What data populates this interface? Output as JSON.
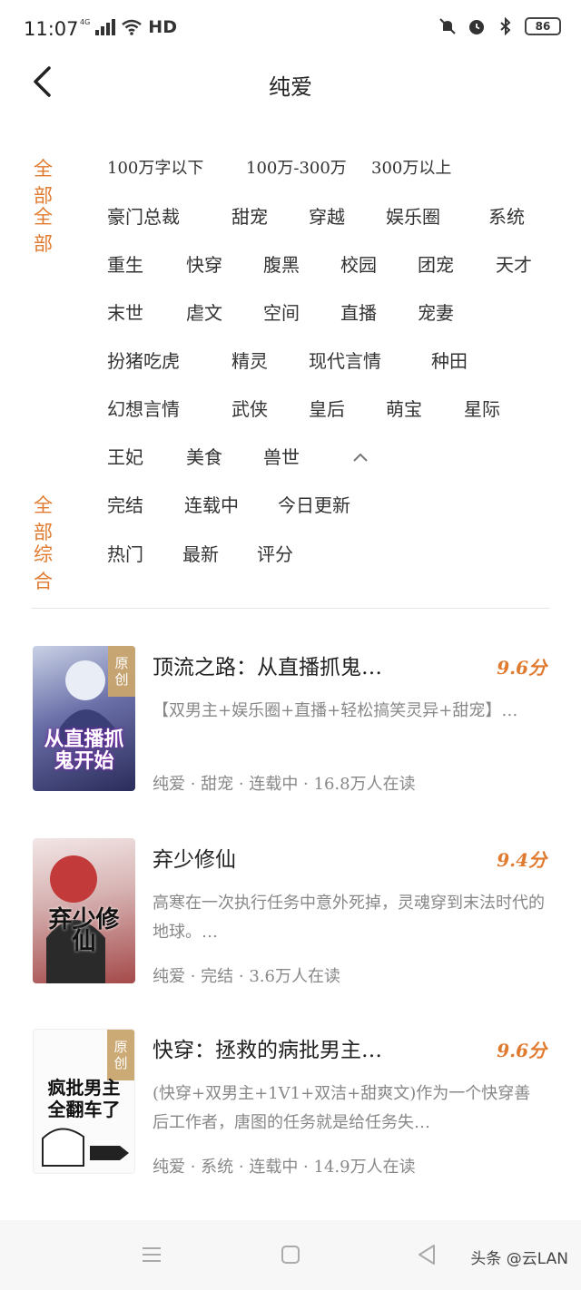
{
  "status_bar": {
    "time": "11:07",
    "network": "4G",
    "hd_label": "HD",
    "battery": "86"
  },
  "header": {
    "title": "纯爱"
  },
  "filters": {
    "word_count": {
      "label": "全部",
      "options": [
        "100万字以下",
        "100万-300万",
        "300万以上"
      ]
    },
    "tags": {
      "label": "全部",
      "options": [
        "豪门总裁",
        "甜宠",
        "穿越",
        "娱乐圈",
        "系统",
        "重生",
        "快穿",
        "腹黑",
        "校园",
        "团宠",
        "天才",
        "末世",
        "虐文",
        "空间",
        "直播",
        "宠妻",
        "扮猪吃虎",
        "精灵",
        "现代言情",
        "种田",
        "幻想言情",
        "武侠",
        "皇后",
        "萌宝",
        "星际",
        "王妃",
        "美食",
        "兽世"
      ]
    },
    "status": {
      "label": "全部",
      "options": [
        "完结",
        "连载中",
        "今日更新"
      ]
    },
    "sort": {
      "label": "综合",
      "options": [
        "热门",
        "最新",
        "评分"
      ]
    }
  },
  "books": [
    {
      "title": "顶流之路：从直播抓鬼…",
      "score": "9.6分",
      "badge": "原创",
      "cover_text": "从直播抓鬼开始",
      "description": "【双男主+娱乐圈+直播+轻松搞笑灵异+甜宠】…",
      "meta": "纯爱 · 甜宠 · 连载中 · 16.8万人在读"
    },
    {
      "title": "弃少修仙",
      "score": "9.4分",
      "badge": "",
      "cover_text": "弃少修仙",
      "description": "高寒在一次执行任务中意外死掉，灵魂穿到末法时代的地球。…",
      "meta": "纯爱 · 完结 · 3.6万人在读"
    },
    {
      "title": "快穿：拯救的病批男主…",
      "score": "9.6分",
      "badge": "原创",
      "cover_text": "疯批男主全翻车了",
      "description": "(快穿+双男主+1V1+双洁+甜爽文)作为一个快穿善后工作者，唐图的任务就是给任务失…",
      "meta": "纯爱 · 系统 · 连载中 · 14.9万人在读"
    }
  ],
  "watermark": "头条 @云LAN",
  "colors": {
    "accent": "#e07a2f",
    "text": "#222222",
    "muted": "#888888"
  }
}
